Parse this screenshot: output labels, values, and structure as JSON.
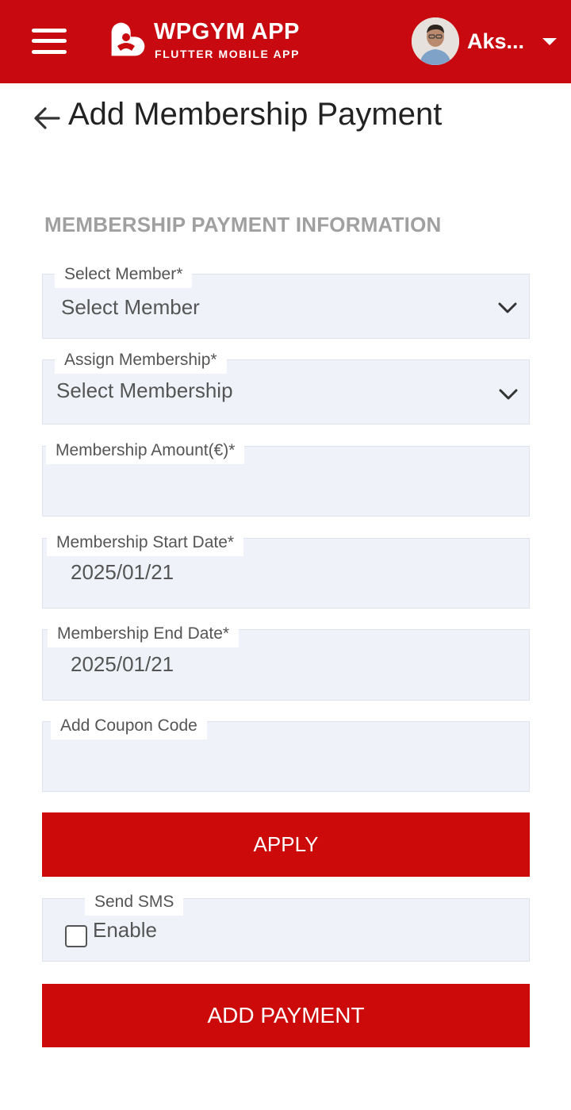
{
  "header": {
    "brand_title": "WPGYM APP",
    "brand_subtitle": "FLUTTER MOBILE APP",
    "user_name": "Aks...",
    "accent_color": "#c8090f"
  },
  "page": {
    "title": "Add Membership Payment",
    "section_heading": "MEMBERSHIP PAYMENT INFORMATION"
  },
  "form": {
    "select_member": {
      "label": "Select Member*",
      "value": "Select Member"
    },
    "assign_membership": {
      "label": "Assign Membership*",
      "value": "Select Membership"
    },
    "membership_amount": {
      "label": "Membership Amount(€)*",
      "value": ""
    },
    "start_date": {
      "label": "Membership Start Date*",
      "value": "2025/01/21"
    },
    "end_date": {
      "label": "Membership End Date*",
      "value": "2025/01/21"
    },
    "coupon_code": {
      "label": "Add Coupon Code",
      "value": ""
    },
    "apply_label": "APPLY",
    "send_sms": {
      "label": "Send SMS",
      "option": "Enable",
      "checked": false
    },
    "submit_label": "ADD PAYMENT"
  },
  "icons": {
    "menu": "menu-icon",
    "logo": "heart-logo-icon",
    "back": "arrow-left-icon",
    "dropdown": "chevron-down-icon",
    "user_menu": "caret-down-icon"
  }
}
